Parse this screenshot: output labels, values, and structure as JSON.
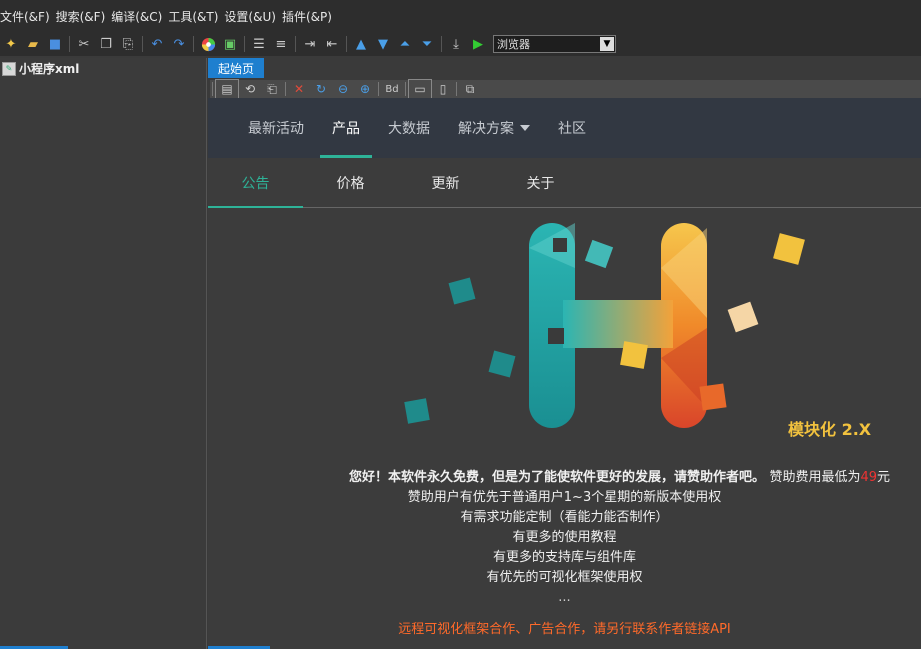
{
  "menu": [
    "文件(&F)",
    "搜索(&F)",
    "编译(&C)",
    "工具(&T)",
    "设置(&U)",
    "插件(&P)"
  ],
  "toolbar": {
    "icons": [
      "new-file-icon",
      "open-folder-icon",
      "save-icon",
      "cut-icon",
      "copy-icon",
      "paste-icon",
      "undo-icon",
      "redo-icon",
      "color-wheel-icon",
      "image-add-icon",
      "align-left-icon",
      "align-center-icon",
      "indent-icon",
      "outdent-icon",
      "arrow-up-icon",
      "arrow-down-icon",
      "move-top-icon",
      "move-bottom-icon",
      "export-icon",
      "run-icon"
    ],
    "browser_select": "浏览器"
  },
  "sidebar": {
    "items": [
      {
        "label": "小程序xml"
      }
    ]
  },
  "document": {
    "tab_label": "起始页"
  },
  "site": {
    "nav": [
      {
        "label": "最新活动"
      },
      {
        "label": "产品"
      },
      {
        "label": "大数据"
      },
      {
        "label": "解决方案"
      },
      {
        "label": "社区"
      }
    ],
    "subtabs": [
      {
        "label": "公告"
      },
      {
        "label": "价格"
      },
      {
        "label": "更新"
      },
      {
        "label": "关于"
      }
    ],
    "logo_text": "模块化 2.X",
    "notice": {
      "line1": "您好！本软件永久免费，但是为了能使软件更好的发展，请赞助作者吧。",
      "line1_tail": "赞助费用最低为",
      "price": "49",
      "unit": "元",
      "line2": "赞助用户有优先于普通用户1~3个星期的新版本使用权",
      "line3": "有需求功能定制（看能力能否制作）",
      "line4": "有更多的使用教程",
      "line5": "有更多的支持库与组件库",
      "line6": "有优先的可视化框架使用权",
      "ellipsis": "...",
      "cooperation": "远程可视化框架合作、广告合作，请另行联系作者链接API"
    }
  },
  "colors": {
    "accent": "#2eb398",
    "tab_blue": "#1e7fcf",
    "nav_bg": "#323842",
    "orange": "#ff6a2a"
  }
}
